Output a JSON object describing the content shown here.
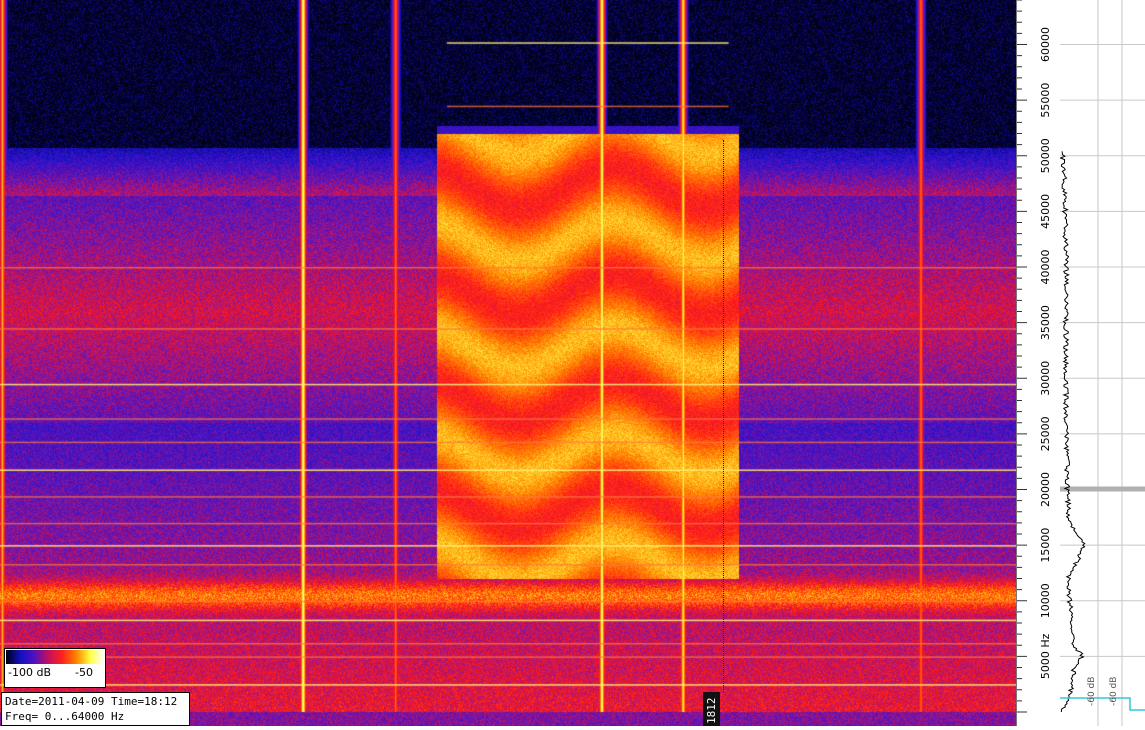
{
  "info": {
    "date_time": "Date=2011-04-09 Time=18:12",
    "freq_range": "Freq= 0...64000 Hz"
  },
  "legend": {
    "min_label": "-100 dB",
    "max_label": "-50"
  },
  "time_marker": "1812",
  "spectrum_axis_labels": [
    "-60 dB",
    "-60 dB"
  ],
  "colors": {
    "background_dark": "#000000",
    "low": "#1a10d0",
    "mid": "#ff1a1a",
    "high": "#ffff40",
    "peak": "#ffffff"
  },
  "chart_data": {
    "type": "heatmap",
    "title": "",
    "xlabel": "",
    "ylabel": "Hz",
    "ylim": [
      0,
      64000
    ],
    "colorbar_db": [
      -100,
      -50
    ],
    "y_ticks": [
      {
        "value": 5000,
        "label": "5000 Hz"
      },
      {
        "value": 10000,
        "label": "10000"
      },
      {
        "value": 15000,
        "label": "15000"
      },
      {
        "value": 20000,
        "label": "20000"
      },
      {
        "value": 25000,
        "label": "25000"
      },
      {
        "value": 30000,
        "label": "30000"
      },
      {
        "value": 35000,
        "label": "35000"
      },
      {
        "value": 40000,
        "label": "40000"
      },
      {
        "value": 45000,
        "label": "45000"
      },
      {
        "value": 50000,
        "label": "50000"
      },
      {
        "value": 55000,
        "label": "55000"
      },
      {
        "value": 60000,
        "label": "60000"
      }
    ],
    "upper_cutoff_hz": 50000,
    "lower_band_hz": 10500,
    "vertical_bursts": [
      {
        "x": 0.002,
        "intensity": 0.55
      },
      {
        "x": 0.298,
        "intensity": 1.0
      },
      {
        "x": 0.389,
        "intensity": 0.35
      },
      {
        "x": 0.592,
        "intensity": 0.95
      },
      {
        "x": 0.672,
        "intensity": 0.8
      },
      {
        "x": 0.906,
        "intensity": 0.35
      }
    ],
    "harmonic_block": {
      "x_start": 0.43,
      "x_end": 0.727,
      "freq_low": 12000,
      "freq_high": 52000
    },
    "horizontal_lines_hz": [
      2500,
      5000,
      6200,
      8300,
      10000,
      13300,
      15000,
      17000,
      19400,
      21800,
      24300,
      26400,
      29500,
      34500,
      40000,
      60200,
      54500
    ],
    "spectrum_profile_hz": [
      [
        1000,
        0.12
      ],
      [
        2500,
        0.28
      ],
      [
        4000,
        0.32
      ],
      [
        5000,
        0.55
      ],
      [
        6000,
        0.3
      ],
      [
        8000,
        0.26
      ],
      [
        10000,
        0.2
      ],
      [
        12000,
        0.16
      ],
      [
        15000,
        0.6
      ],
      [
        17000,
        0.18
      ],
      [
        20000,
        0.14
      ],
      [
        25000,
        0.12
      ],
      [
        30000,
        0.1
      ],
      [
        35000,
        0.1
      ],
      [
        40000,
        0.11
      ],
      [
        45000,
        0.08
      ],
      [
        49000,
        0.05
      ],
      [
        50500,
        0.0
      ]
    ]
  }
}
